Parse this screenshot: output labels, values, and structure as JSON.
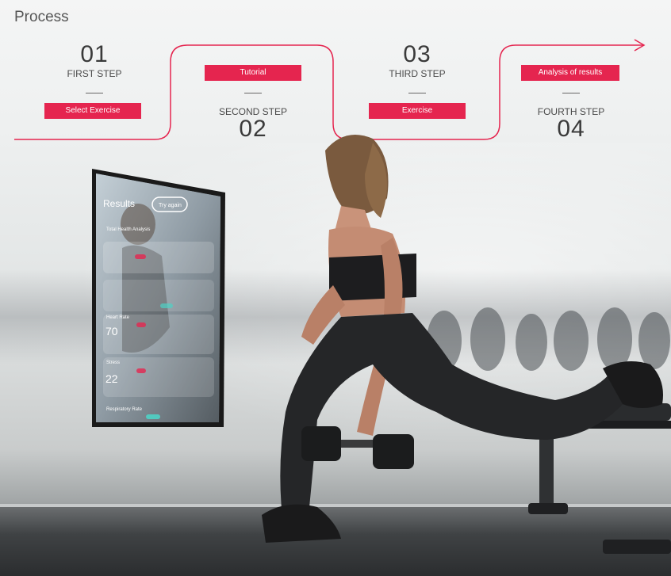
{
  "header": {
    "title": "Process"
  },
  "steps": [
    {
      "number": "01",
      "label": "FIRST STEP",
      "tag": "Select Exercise"
    },
    {
      "number": "02",
      "label": "SECOND STEP",
      "tag": "Tutorial"
    },
    {
      "number": "03",
      "label": "THIRD STEP",
      "tag": "Exercise"
    },
    {
      "number": "04",
      "label": "FOURTH STEP",
      "tag": "Analysis of results"
    }
  ],
  "mirror": {
    "title": "Results",
    "try_again": "Try again",
    "total_health": "Total Health Analysis",
    "heart_rate": "Heart Rate",
    "heart_value": "70",
    "stress": "Stress",
    "stress_value": "22",
    "respiratory": "Respiratory Rate"
  },
  "colors": {
    "accent": "#e5254f",
    "text": "#3a3a3a"
  }
}
